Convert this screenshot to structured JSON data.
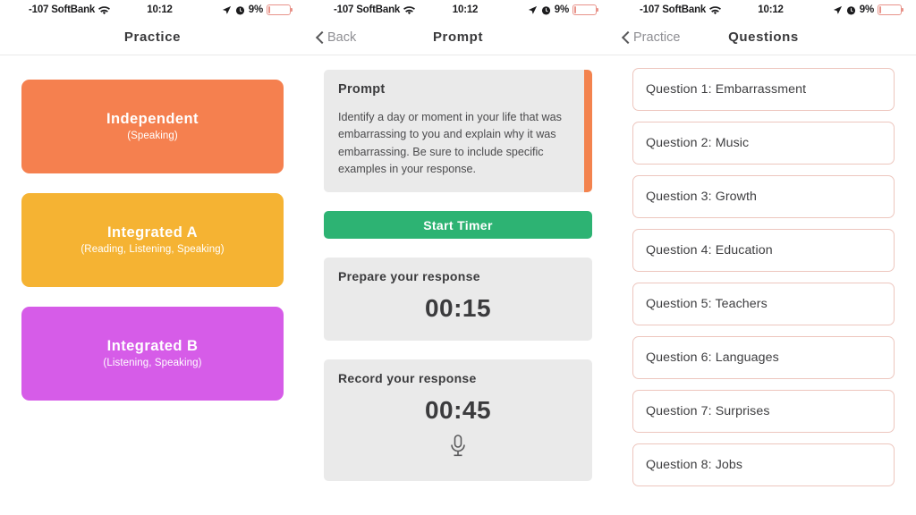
{
  "status_bar": {
    "carrier": "-107 SoftBank",
    "wifi_icon": "wifi-icon",
    "time": "10:12",
    "location_icon": "location-arrow-icon",
    "alarm_icon": "alarm-clock-icon",
    "battery_percent": "9%",
    "battery_level": 9,
    "battery_color": "#e8938a"
  },
  "screens": [
    {
      "nav": {
        "title": "Practice",
        "back_label": "",
        "has_back": false
      },
      "buttons": [
        {
          "title": "Independent",
          "subtitle": "(Speaking)",
          "color": "#f5804f",
          "name": "practice-independent-button"
        },
        {
          "title": "Integrated A",
          "subtitle": "(Reading, Listening, Speaking)",
          "color": "#f5b333",
          "name": "practice-integrated-a-button"
        },
        {
          "title": "Integrated B",
          "subtitle": "(Listening, Speaking)",
          "color": "#d65ce8",
          "name": "practice-integrated-b-button"
        }
      ]
    },
    {
      "nav": {
        "title": "Prompt",
        "back_label": "Back",
        "has_back": true
      },
      "prompt": {
        "heading": "Prompt",
        "text": "Identify a day or moment in your life that was embarrassing to you and explain why it was embarrassing. Be sure to include specific examples in your response.",
        "scroll_indicator_color": "#f3834e"
      },
      "start_button": {
        "label": "Start Timer",
        "color": "#2db373"
      },
      "timers": [
        {
          "label": "Prepare your response",
          "value": "00:15",
          "has_mic": false
        },
        {
          "label": "Record your response",
          "value": "00:45",
          "has_mic": true
        }
      ]
    },
    {
      "nav": {
        "title": "Questions",
        "back_label": "Practice",
        "has_back": true
      },
      "questions": [
        "Question 1: Embarrassment",
        "Question 2: Music",
        "Question 3: Growth",
        "Question 4: Education",
        "Question 5: Teachers",
        "Question 6: Languages",
        "Question 7: Surprises",
        "Question 8: Jobs"
      ],
      "card_border_color": "#edc6be"
    }
  ]
}
